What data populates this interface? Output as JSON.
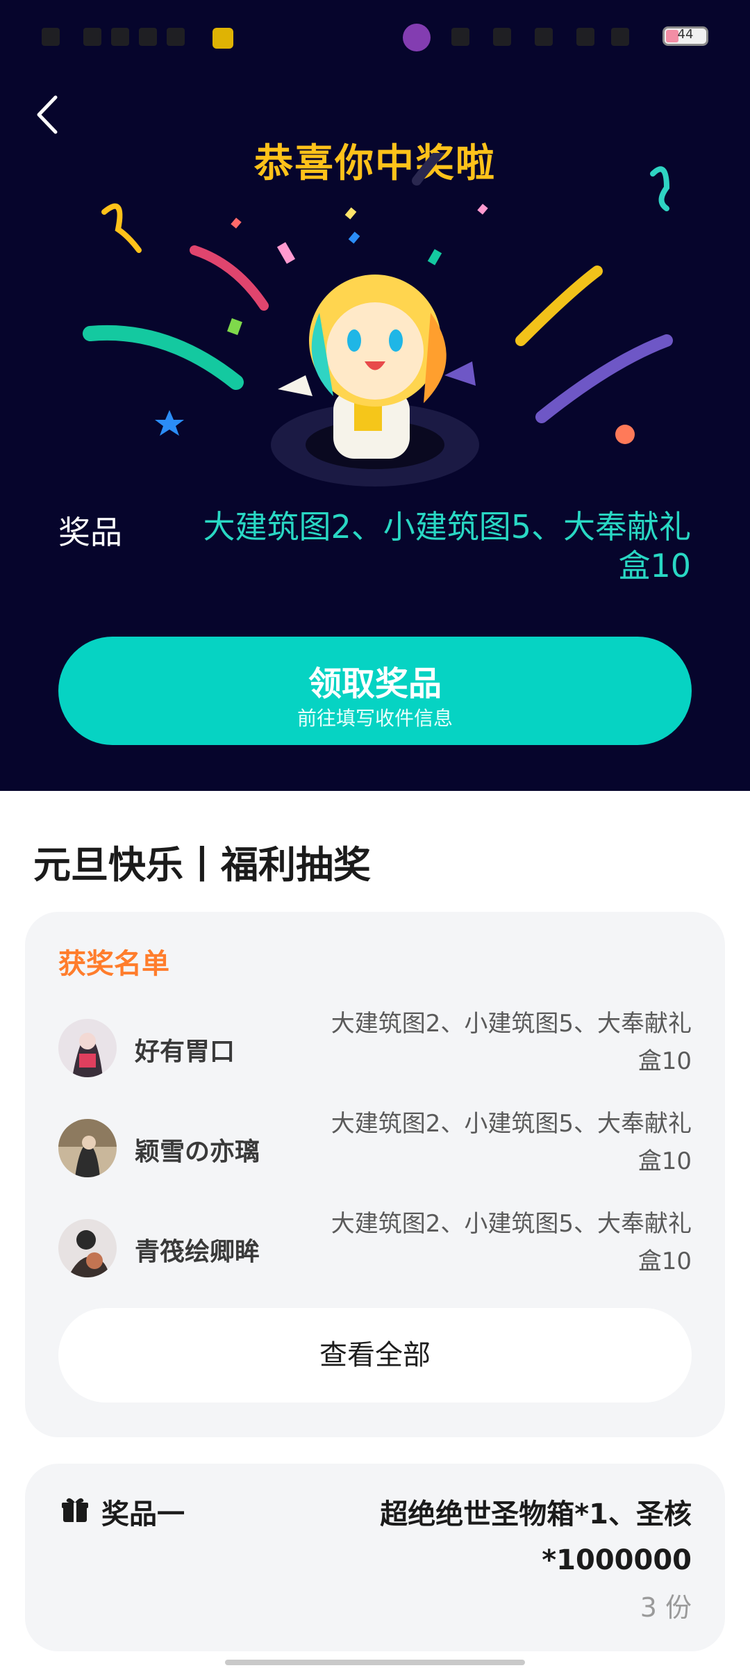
{
  "status_bar": {
    "battery": "44"
  },
  "hero": {
    "congrats_text": "恭喜你中奖啦",
    "prize_label": "奖品",
    "prize_value": "大建筑图2、小建筑图5、大奉献礼盒10",
    "claim": {
      "title": "领取奖品",
      "subtitle": "前往填写收件信息"
    }
  },
  "event": {
    "title": "元旦快乐丨福利抽奖"
  },
  "winners": {
    "title": "获奖名单",
    "items": [
      {
        "name": "好有胃口",
        "prize": "大建筑图2、小建筑图5、大奉献礼盒10"
      },
      {
        "name": "颖雪の亦璃",
        "prize": "大建筑图2、小建筑图5、大奉献礼盒10"
      },
      {
        "name": "青筏绘卿眸",
        "prize": "大建筑图2、小建筑图5、大奉献礼盒10"
      }
    ],
    "view_all": "查看全部"
  },
  "prizes": [
    {
      "label": "奖品一",
      "value": "超绝绝世圣物箱*1、圣核*1000000",
      "count": "3 份"
    }
  ],
  "colors": {
    "hero_bg": "#06052c",
    "accent_teal": "#06d3c3",
    "congrats_yellow": "#ffc21a",
    "winners_title_orange": "#ff7d2c"
  }
}
